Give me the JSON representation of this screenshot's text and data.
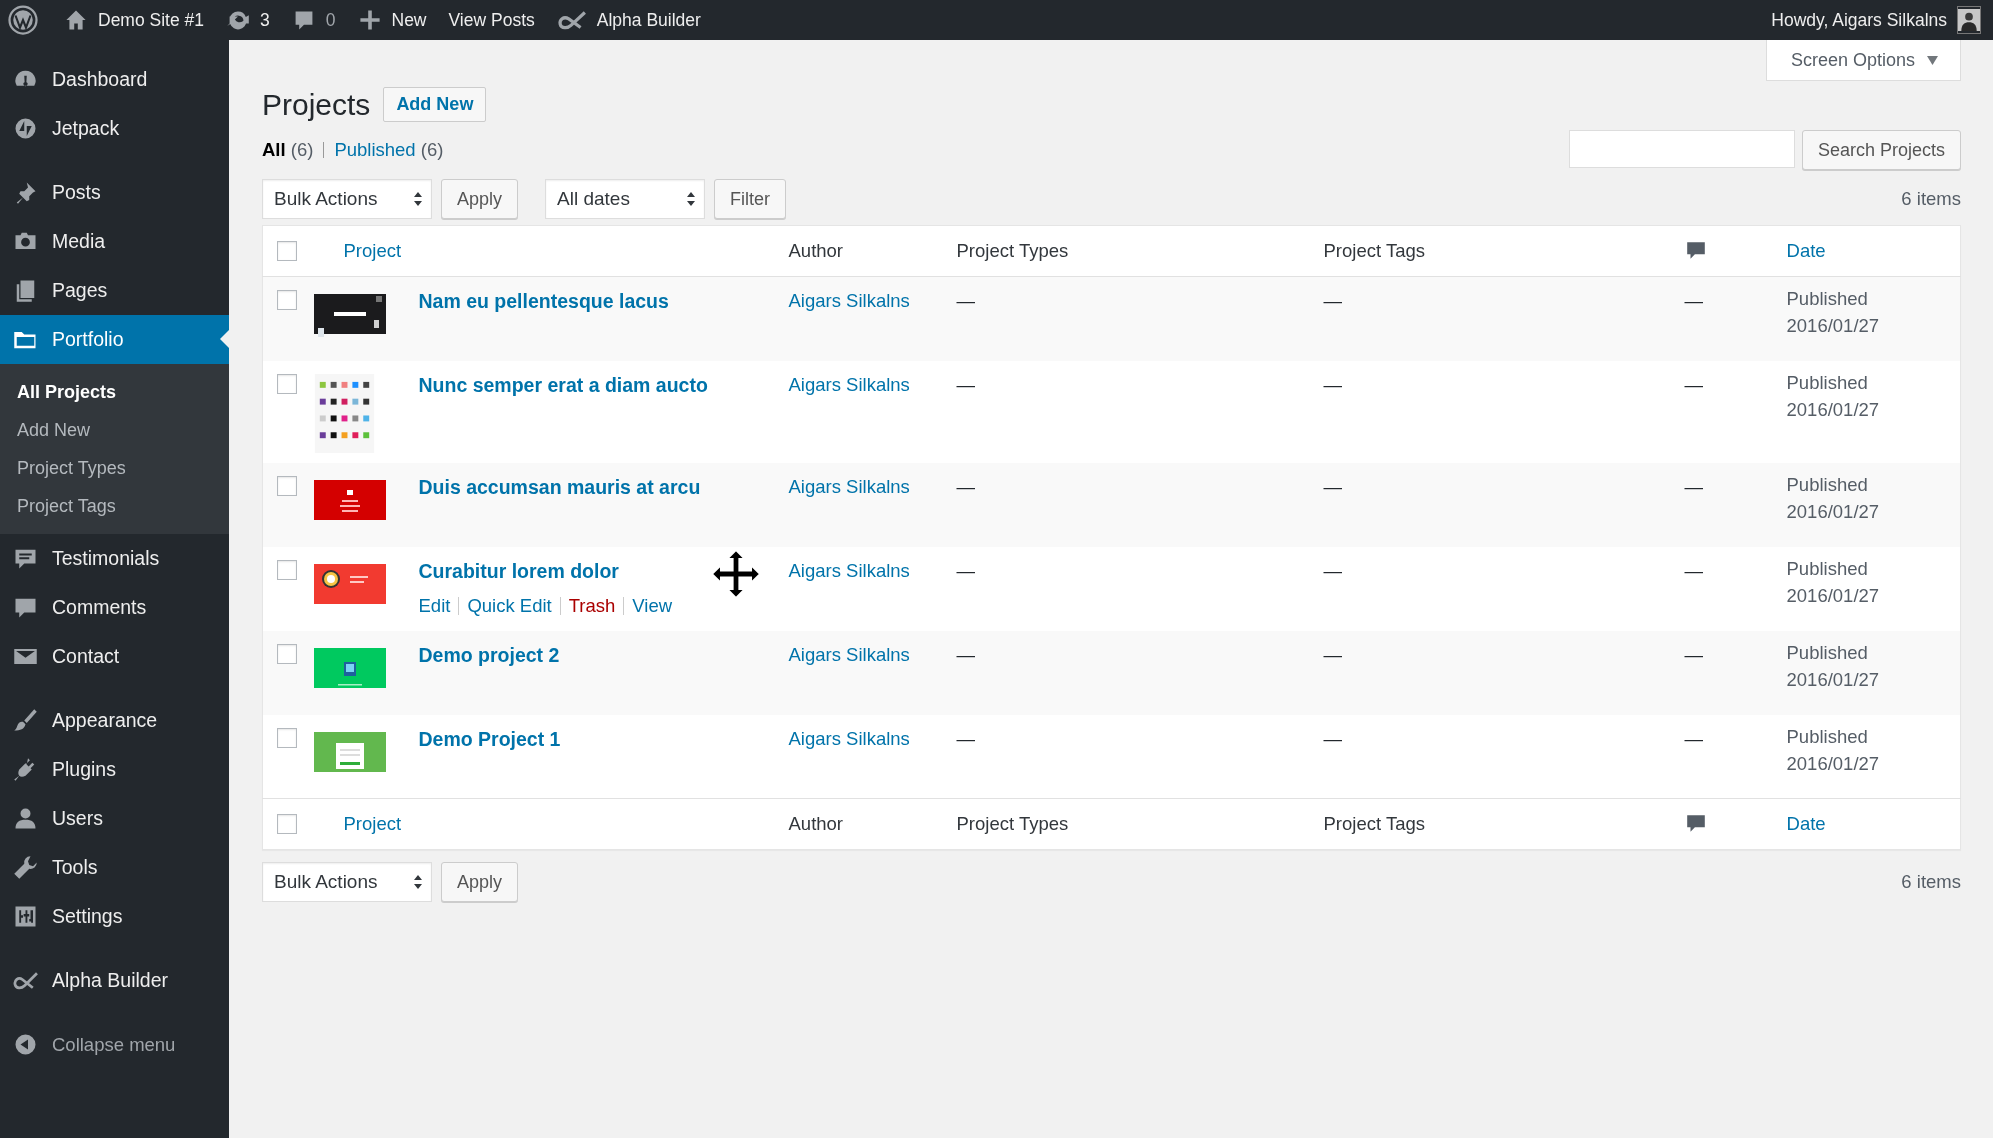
{
  "admin_bar": {
    "items": [
      {
        "kind": "logo"
      },
      {
        "kind": "site",
        "label": "Demo Site #1"
      },
      {
        "kind": "updates",
        "label": "3"
      },
      {
        "kind": "comments",
        "label": "0"
      },
      {
        "kind": "new",
        "label": "New"
      },
      {
        "kind": "link",
        "label": "View Posts"
      },
      {
        "kind": "builder",
        "label": "Alpha Builder"
      }
    ],
    "account": "Howdy, Aigars Silkalns"
  },
  "sidebar": {
    "groups": [
      [
        {
          "kind": "dashboard",
          "label": "Dashboard",
          "selected": false
        },
        {
          "kind": "jetpack",
          "label": "Jetpack",
          "selected": false
        }
      ],
      [
        {
          "kind": "posts",
          "label": "Posts",
          "selected": false
        },
        {
          "kind": "media",
          "label": "Media",
          "selected": false
        },
        {
          "kind": "pages",
          "label": "Pages",
          "selected": false
        },
        {
          "kind": "portfolio",
          "label": "Portfolio",
          "selected": true,
          "children": [
            {
              "label": "All Projects",
              "selected": true
            },
            {
              "label": "Add New",
              "selected": false
            },
            {
              "label": "Project Types",
              "selected": false
            },
            {
              "label": "Project Tags",
              "selected": false
            }
          ]
        },
        {
          "kind": "testimonials",
          "label": "Testimonials",
          "selected": false
        },
        {
          "kind": "comments",
          "label": "Comments",
          "selected": false
        },
        {
          "kind": "contact",
          "label": "Contact",
          "selected": false
        }
      ],
      [
        {
          "kind": "appearance",
          "label": "Appearance",
          "selected": false
        },
        {
          "kind": "plugins",
          "label": "Plugins",
          "selected": false
        },
        {
          "kind": "users",
          "label": "Users",
          "selected": false
        },
        {
          "kind": "tools",
          "label": "Tools",
          "selected": false
        },
        {
          "kind": "settings",
          "label": "Settings",
          "selected": false
        }
      ],
      [
        {
          "kind": "builder",
          "label": "Alpha Builder",
          "selected": false
        }
      ]
    ],
    "collapse": "Collapse menu"
  },
  "screen_options": "Screen Options",
  "title": "Projects",
  "add_new": "Add New",
  "views": [
    {
      "label": "All",
      "count": "(6)",
      "selected": true
    },
    {
      "label": "Published",
      "count": "(6)",
      "selected": false
    }
  ],
  "search_button": "Search Projects",
  "top_actions": {
    "bulk": "Bulk Actions",
    "apply": "Apply",
    "dates": "All dates",
    "filter": "Filter",
    "count": "6 items"
  },
  "table": {
    "header_checkbox": {
      "checked": false
    },
    "footer_checkbox": {
      "checked": false
    },
    "header": [
      {
        "kind": "text",
        "label": "Project",
        "sortable": true
      },
      {
        "kind": "text",
        "label": "Author",
        "sortable": false
      },
      {
        "kind": "text",
        "label": "Project Types",
        "sortable": false
      },
      {
        "kind": "text",
        "label": "Project Tags",
        "sortable": false
      },
      {
        "kind": "comments"
      },
      {
        "kind": "text",
        "label": "Date",
        "sortable": true
      }
    ],
    "rows": [
      {
        "thumbnail": {
          "kind": "picture"
        },
        "title": "Nam eu pellentesque lacus",
        "checked": false,
        "author": "Aigars Silkalns",
        "types": "—",
        "tags": "—",
        "comments": "—",
        "status": "Published",
        "date": "2016/01/27"
      },
      {
        "thumbnail": {
          "kind": "picture"
        },
        "title": "Nunc semper erat a diam aucto",
        "checked": false,
        "author": "Aigars Silkalns",
        "types": "—",
        "tags": "—",
        "comments": "—",
        "status": "Published",
        "date": "2016/01/27"
      },
      {
        "thumbnail": {
          "kind": "picture"
        },
        "title": "Duis accumsan mauris at arcu",
        "checked": false,
        "author": "Aigars Silkalns",
        "types": "—",
        "tags": "—",
        "comments": "—",
        "status": "Published",
        "date": "2016/01/27"
      },
      {
        "thumbnail": {
          "kind": "picture"
        },
        "title": "Curabitur lorem dolor",
        "checked": false,
        "actions": [
          {
            "kind": "link",
            "label": "Edit"
          },
          {
            "kind": "link",
            "label": "Quick Edit"
          },
          {
            "kind": "delete",
            "label": "Trash"
          },
          {
            "kind": "link",
            "label": "View"
          }
        ],
        "author": "Aigars Silkalns",
        "types": "—",
        "tags": "—",
        "comments": "—",
        "status": "Published",
        "date": "2016/01/27"
      },
      {
        "thumbnail": {
          "kind": "picture"
        },
        "title": "Demo project 2",
        "checked": false,
        "author": "Aigars Silkalns",
        "types": "—",
        "tags": "—",
        "comments": "—",
        "status": "Published",
        "date": "2016/01/27"
      },
      {
        "thumbnail": {
          "kind": "picture"
        },
        "title": "Demo Project 1",
        "checked": false,
        "author": "Aigars Silkalns",
        "types": "—",
        "tags": "—",
        "comments": "—",
        "status": "Published",
        "date": "2016/01/27"
      }
    ],
    "footer": [
      {
        "kind": "text",
        "label": "Project",
        "sortable": true
      },
      {
        "kind": "text",
        "label": "Author",
        "sortable": false
      },
      {
        "kind": "text",
        "label": "Project Types",
        "sortable": false
      },
      {
        "kind": "text",
        "label": "Project Tags",
        "sortable": false
      },
      {
        "kind": "comments"
      },
      {
        "kind": "text",
        "label": "Date",
        "sortable": true
      }
    ]
  },
  "bottom_actions": {
    "bulk": "Bulk Actions",
    "apply": "Apply",
    "count": "6 items"
  }
}
